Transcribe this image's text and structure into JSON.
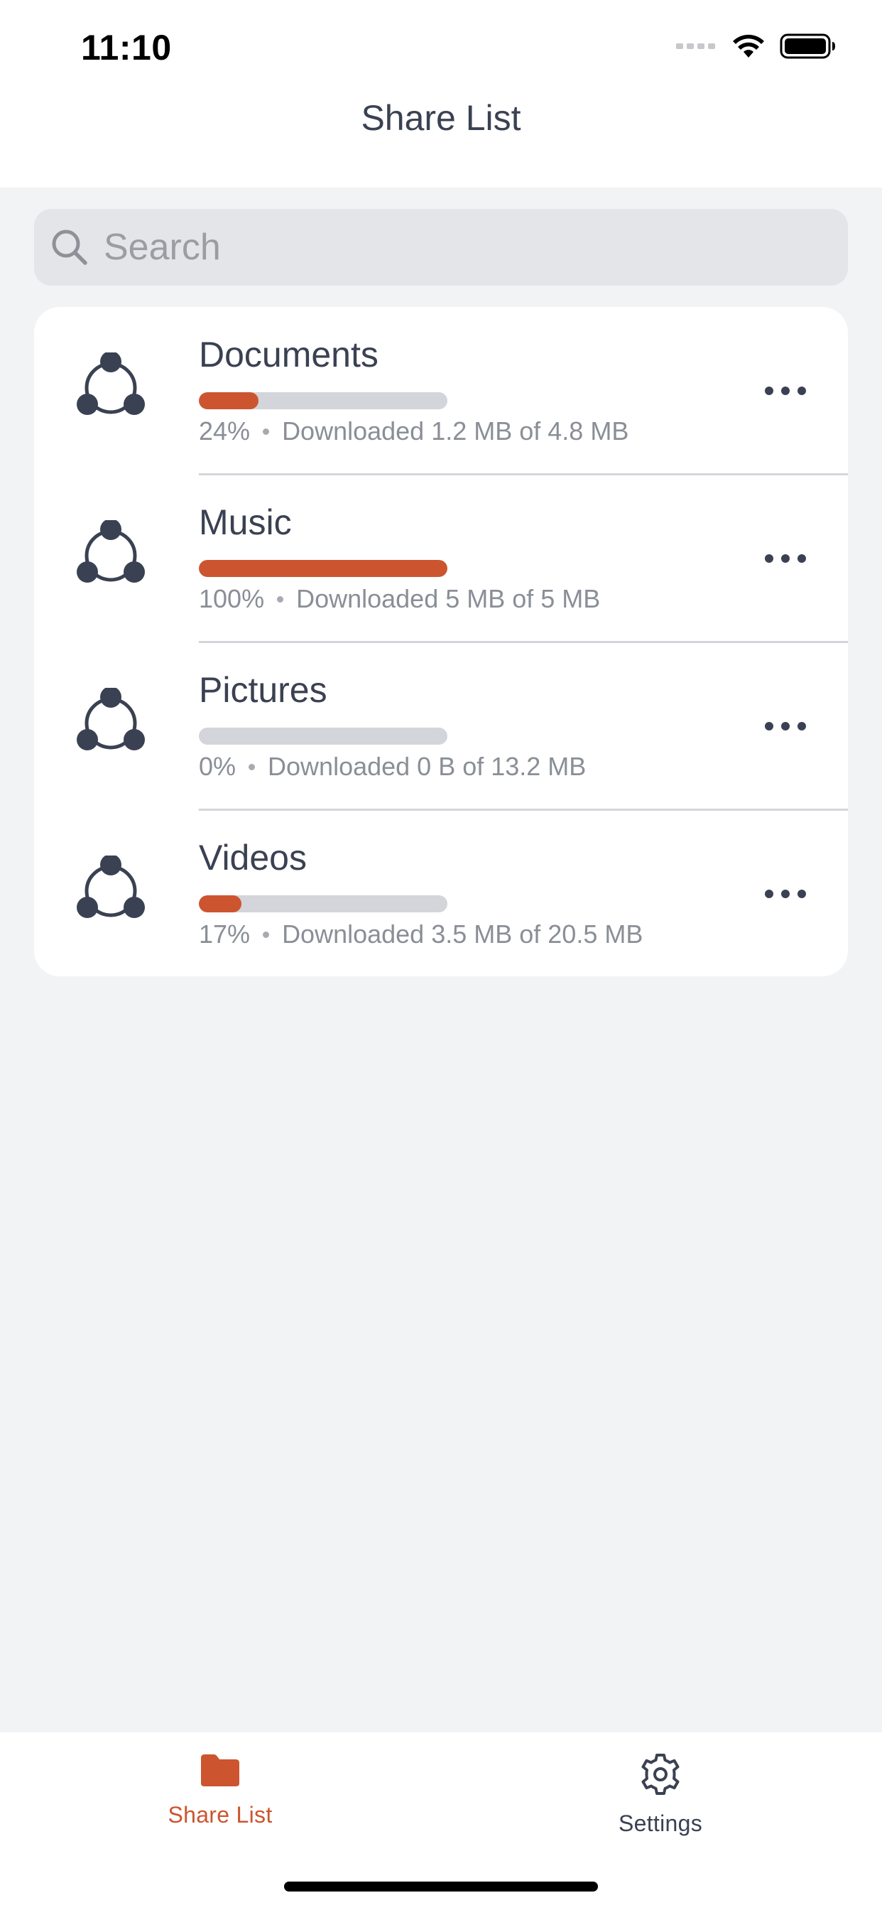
{
  "status_bar": {
    "time": "11:10"
  },
  "header": {
    "title": "Share List"
  },
  "search": {
    "placeholder": "Search"
  },
  "shares": [
    {
      "name": "Documents",
      "percent_label": "24%",
      "progress": 0.24,
      "detail": "Downloaded 1.2 MB of 4.8 MB"
    },
    {
      "name": "Music",
      "percent_label": "100%",
      "progress": 1.0,
      "detail": "Downloaded 5 MB of 5 MB"
    },
    {
      "name": "Pictures",
      "percent_label": "0%",
      "progress": 0.0,
      "detail": "Downloaded 0 B of 13.2 MB"
    },
    {
      "name": "Videos",
      "percent_label": "17%",
      "progress": 0.17,
      "detail": "Downloaded 3.5 MB of 20.5 MB"
    }
  ],
  "tab_bar": {
    "items": [
      {
        "label": "Share List",
        "icon": "folder-icon",
        "active": true
      },
      {
        "label": "Settings",
        "icon": "gear-icon",
        "active": false
      }
    ]
  },
  "colors": {
    "accent": "#cc5530",
    "text": "#3a4152",
    "secondary_text": "#8a8e96",
    "track": "#d3d5da",
    "background": "#f2f3f5"
  },
  "icons": {
    "share_item": "share-network-icon",
    "more": "ellipsis-icon",
    "search": "search-icon"
  }
}
